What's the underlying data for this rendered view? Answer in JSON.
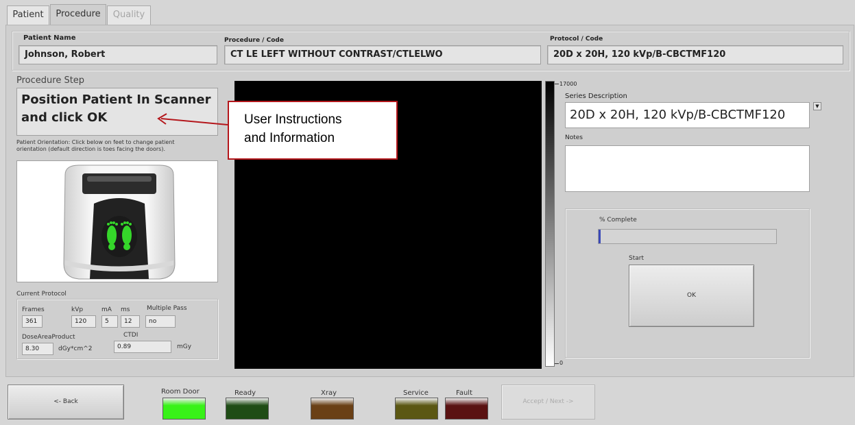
{
  "tabs": [
    {
      "label": "Patient"
    },
    {
      "label": "Procedure"
    },
    {
      "label": "Quality"
    }
  ],
  "header": {
    "patient_name_label": "Patient Name",
    "patient_name": "Johnson, Robert",
    "procedure_label": "Procedure / Code",
    "procedure": "CT LE LEFT WITHOUT CONTRAST/CTLELWO",
    "protocol_label": "Protocol / Code",
    "protocol": "20D x 20H, 120 kVp/B-CBCTMF120"
  },
  "step": {
    "label": "Procedure Step",
    "text_line1": "Position Patient In Scanner",
    "text_line2": "and click OK",
    "orientation_line1": "Patient Orientation: Click below on feet to change patient",
    "orientation_line2": "orientation (default direction is toes facing the doors)."
  },
  "current_protocol": {
    "label": "Current Protocol",
    "frames_label": "Frames",
    "frames": "361",
    "kvp_label": "kVp",
    "kvp": "120",
    "ma_label": "mA",
    "ma": "5",
    "ms_label": "ms",
    "ms": "12",
    "multipass_label": "Multiple Pass",
    "multipass": "no",
    "dap_label": "DoseAreaProduct",
    "dap": "8.30",
    "dap_unit": "dGy*cm^2",
    "ctdi_label": "CTDI",
    "ctdi": "0.89",
    "ctdi_unit": "mGy"
  },
  "scale": {
    "max": "17000",
    "min": "0"
  },
  "right": {
    "series_label": "Series Description",
    "series": "20D x 20H, 120 kVp/B-CBCTMF120",
    "notes_label": "Notes",
    "notes": "",
    "complete_label": "% Complete",
    "progress": 0.01,
    "start_label": "Start",
    "ok_label": "OK"
  },
  "annotation": {
    "line1": "User Instructions",
    "line2": "and Information"
  },
  "footer": {
    "back_label": "<- Back",
    "next_label": "Accept / Next ->",
    "indicators": [
      {
        "label": "Room Door",
        "color": "#38f218"
      },
      {
        "label": "Ready",
        "color": "#1f4c16"
      },
      {
        "label": "Xray",
        "color": "#6a4016"
      },
      {
        "label": "Service",
        "color": "#5b5713"
      },
      {
        "label": "Fault",
        "color": "#5a1212"
      }
    ]
  }
}
